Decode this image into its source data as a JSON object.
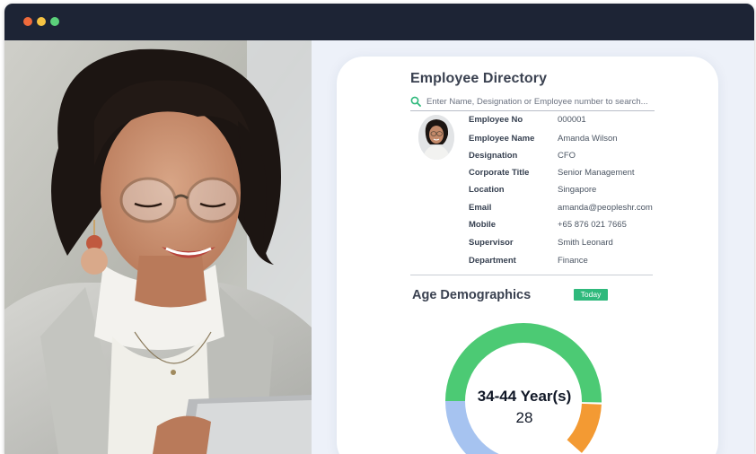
{
  "window": {
    "controls": [
      "close",
      "minimize",
      "maximize"
    ]
  },
  "directory": {
    "title": "Employee Directory",
    "search_placeholder": "Enter Name, Designation or Employee number to search...",
    "employee": {
      "fields": [
        {
          "label": "Employee No",
          "value": "000001"
        },
        {
          "label": "Employee Name",
          "value": "Amanda Wilson"
        },
        {
          "label": "Designation",
          "value": "CFO"
        },
        {
          "label": "Corporate Title",
          "value": "Senior Management"
        },
        {
          "label": "Location",
          "value": "Singapore"
        },
        {
          "label": "Email",
          "value": "amanda@peopleshr.com"
        },
        {
          "label": "Mobile",
          "value": "+65 876 021 7665"
        },
        {
          "label": "Supervisor",
          "value": "Smith Leonard"
        },
        {
          "label": "Department",
          "value": "Finance"
        }
      ]
    }
  },
  "age_demographics": {
    "title": "Age Demographics",
    "badge": "Today",
    "highlight_range": "34-44 Year(s)",
    "highlight_count": "28",
    "colors": {
      "green": "#4cca74",
      "blue": "#a6c3f0",
      "orange": "#f39a33",
      "badge": "#2fb97c"
    }
  },
  "colors": {
    "titlebar": "#1d2435",
    "dot_red": "#ef6a3b",
    "dot_yellow": "#f6c343",
    "dot_green": "#5bd17a",
    "accent_green": "#2fb97c"
  }
}
